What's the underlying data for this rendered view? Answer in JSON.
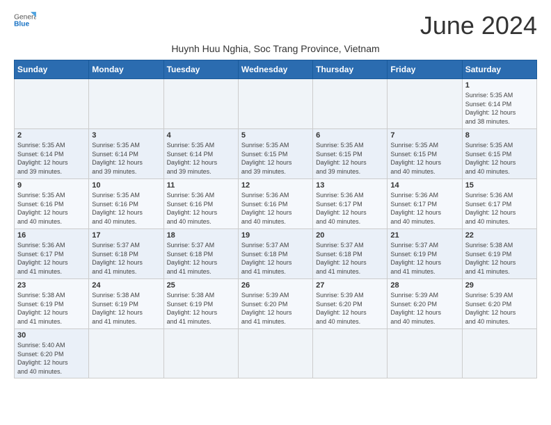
{
  "logo": {
    "text_general": "General",
    "text_blue": "Blue"
  },
  "title": "June 2024",
  "subtitle": "Huynh Huu Nghia, Soc Trang Province, Vietnam",
  "weekdays": [
    "Sunday",
    "Monday",
    "Tuesday",
    "Wednesday",
    "Thursday",
    "Friday",
    "Saturday"
  ],
  "weeks": [
    [
      {
        "day": "",
        "info": ""
      },
      {
        "day": "",
        "info": ""
      },
      {
        "day": "",
        "info": ""
      },
      {
        "day": "",
        "info": ""
      },
      {
        "day": "",
        "info": ""
      },
      {
        "day": "",
        "info": ""
      },
      {
        "day": "1",
        "info": "Sunrise: 5:35 AM\nSunset: 6:14 PM\nDaylight: 12 hours\nand 38 minutes."
      }
    ],
    [
      {
        "day": "2",
        "info": "Sunrise: 5:35 AM\nSunset: 6:14 PM\nDaylight: 12 hours\nand 39 minutes."
      },
      {
        "day": "3",
        "info": "Sunrise: 5:35 AM\nSunset: 6:14 PM\nDaylight: 12 hours\nand 39 minutes."
      },
      {
        "day": "4",
        "info": "Sunrise: 5:35 AM\nSunset: 6:14 PM\nDaylight: 12 hours\nand 39 minutes."
      },
      {
        "day": "5",
        "info": "Sunrise: 5:35 AM\nSunset: 6:15 PM\nDaylight: 12 hours\nand 39 minutes."
      },
      {
        "day": "6",
        "info": "Sunrise: 5:35 AM\nSunset: 6:15 PM\nDaylight: 12 hours\nand 39 minutes."
      },
      {
        "day": "7",
        "info": "Sunrise: 5:35 AM\nSunset: 6:15 PM\nDaylight: 12 hours\nand 40 minutes."
      },
      {
        "day": "8",
        "info": "Sunrise: 5:35 AM\nSunset: 6:15 PM\nDaylight: 12 hours\nand 40 minutes."
      }
    ],
    [
      {
        "day": "9",
        "info": "Sunrise: 5:35 AM\nSunset: 6:16 PM\nDaylight: 12 hours\nand 40 minutes."
      },
      {
        "day": "10",
        "info": "Sunrise: 5:35 AM\nSunset: 6:16 PM\nDaylight: 12 hours\nand 40 minutes."
      },
      {
        "day": "11",
        "info": "Sunrise: 5:36 AM\nSunset: 6:16 PM\nDaylight: 12 hours\nand 40 minutes."
      },
      {
        "day": "12",
        "info": "Sunrise: 5:36 AM\nSunset: 6:16 PM\nDaylight: 12 hours\nand 40 minutes."
      },
      {
        "day": "13",
        "info": "Sunrise: 5:36 AM\nSunset: 6:17 PM\nDaylight: 12 hours\nand 40 minutes."
      },
      {
        "day": "14",
        "info": "Sunrise: 5:36 AM\nSunset: 6:17 PM\nDaylight: 12 hours\nand 40 minutes."
      },
      {
        "day": "15",
        "info": "Sunrise: 5:36 AM\nSunset: 6:17 PM\nDaylight: 12 hours\nand 40 minutes."
      }
    ],
    [
      {
        "day": "16",
        "info": "Sunrise: 5:36 AM\nSunset: 6:17 PM\nDaylight: 12 hours\nand 41 minutes."
      },
      {
        "day": "17",
        "info": "Sunrise: 5:37 AM\nSunset: 6:18 PM\nDaylight: 12 hours\nand 41 minutes."
      },
      {
        "day": "18",
        "info": "Sunrise: 5:37 AM\nSunset: 6:18 PM\nDaylight: 12 hours\nand 41 minutes."
      },
      {
        "day": "19",
        "info": "Sunrise: 5:37 AM\nSunset: 6:18 PM\nDaylight: 12 hours\nand 41 minutes."
      },
      {
        "day": "20",
        "info": "Sunrise: 5:37 AM\nSunset: 6:18 PM\nDaylight: 12 hours\nand 41 minutes."
      },
      {
        "day": "21",
        "info": "Sunrise: 5:37 AM\nSunset: 6:19 PM\nDaylight: 12 hours\nand 41 minutes."
      },
      {
        "day": "22",
        "info": "Sunrise: 5:38 AM\nSunset: 6:19 PM\nDaylight: 12 hours\nand 41 minutes."
      }
    ],
    [
      {
        "day": "23",
        "info": "Sunrise: 5:38 AM\nSunset: 6:19 PM\nDaylight: 12 hours\nand 41 minutes."
      },
      {
        "day": "24",
        "info": "Sunrise: 5:38 AM\nSunset: 6:19 PM\nDaylight: 12 hours\nand 41 minutes."
      },
      {
        "day": "25",
        "info": "Sunrise: 5:38 AM\nSunset: 6:19 PM\nDaylight: 12 hours\nand 41 minutes."
      },
      {
        "day": "26",
        "info": "Sunrise: 5:39 AM\nSunset: 6:20 PM\nDaylight: 12 hours\nand 41 minutes."
      },
      {
        "day": "27",
        "info": "Sunrise: 5:39 AM\nSunset: 6:20 PM\nDaylight: 12 hours\nand 40 minutes."
      },
      {
        "day": "28",
        "info": "Sunrise: 5:39 AM\nSunset: 6:20 PM\nDaylight: 12 hours\nand 40 minutes."
      },
      {
        "day": "29",
        "info": "Sunrise: 5:39 AM\nSunset: 6:20 PM\nDaylight: 12 hours\nand 40 minutes."
      }
    ],
    [
      {
        "day": "30",
        "info": "Sunrise: 5:40 AM\nSunset: 6:20 PM\nDaylight: 12 hours\nand 40 minutes."
      },
      {
        "day": "",
        "info": ""
      },
      {
        "day": "",
        "info": ""
      },
      {
        "day": "",
        "info": ""
      },
      {
        "day": "",
        "info": ""
      },
      {
        "day": "",
        "info": ""
      },
      {
        "day": "",
        "info": ""
      }
    ]
  ]
}
